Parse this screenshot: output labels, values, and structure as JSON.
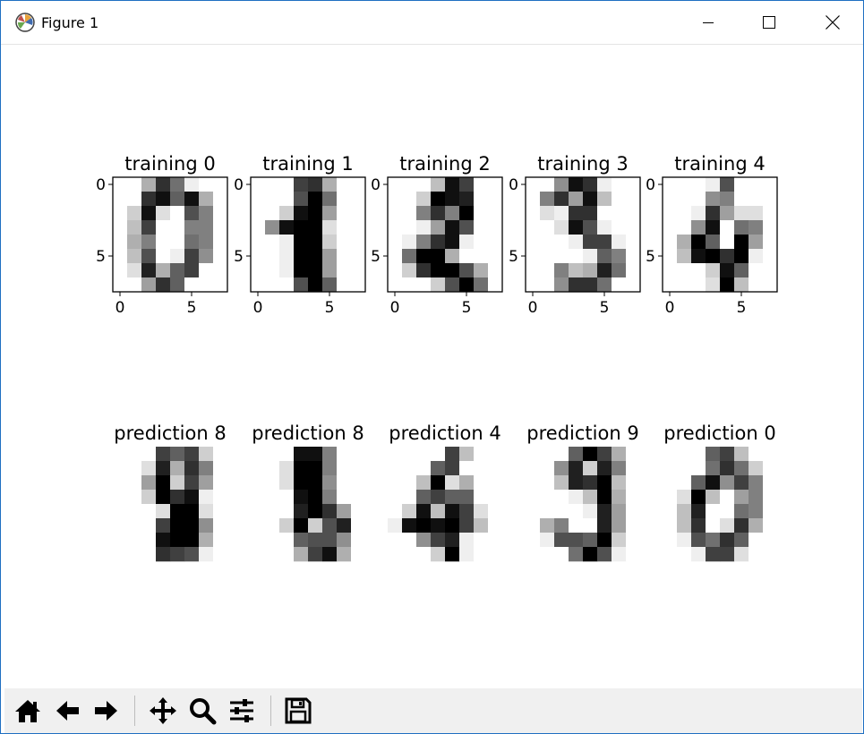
{
  "window": {
    "title": "Figure 1"
  },
  "icons": {
    "app": "matplotlib-icon",
    "minimize": "minimize-icon",
    "maximize": "maximize-icon",
    "close": "close-icon",
    "toolbar": [
      "home-icon",
      "back-arrow-icon",
      "forward-arrow-icon",
      "pan-icon",
      "zoom-icon",
      "configure-subplots-icon",
      "save-icon"
    ]
  },
  "chart_data": {
    "type": "heatmap",
    "colormap": "gray_r",
    "value_range": [
      0,
      16
    ],
    "panels": [
      {
        "title": "training 0",
        "row": "training",
        "axes": true,
        "xticks": [
          "0",
          "5"
        ],
        "yticks": [
          "0",
          "5"
        ],
        "values": [
          [
            0,
            0,
            5,
            13,
            9,
            1,
            0,
            0
          ],
          [
            0,
            0,
            13,
            15,
            10,
            15,
            5,
            0
          ],
          [
            0,
            3,
            15,
            2,
            0,
            11,
            8,
            0
          ],
          [
            0,
            4,
            12,
            0,
            0,
            8,
            8,
            0
          ],
          [
            0,
            5,
            8,
            0,
            0,
            9,
            8,
            0
          ],
          [
            0,
            4,
            11,
            0,
            1,
            12,
            7,
            0
          ],
          [
            0,
            2,
            14,
            5,
            10,
            12,
            0,
            0
          ],
          [
            0,
            0,
            6,
            13,
            10,
            0,
            0,
            0
          ]
        ]
      },
      {
        "title": "training 1",
        "row": "training",
        "axes": true,
        "xticks": [
          "0",
          "5"
        ],
        "yticks": [
          "0",
          "5"
        ],
        "values": [
          [
            0,
            0,
            0,
            12,
            13,
            5,
            0,
            0
          ],
          [
            0,
            0,
            0,
            11,
            16,
            9,
            0,
            0
          ],
          [
            0,
            0,
            3,
            15,
            16,
            6,
            0,
            0
          ],
          [
            0,
            7,
            15,
            16,
            16,
            2,
            0,
            0
          ],
          [
            0,
            0,
            1,
            16,
            16,
            3,
            0,
            0
          ],
          [
            0,
            0,
            1,
            16,
            16,
            6,
            0,
            0
          ],
          [
            0,
            0,
            1,
            16,
            16,
            6,
            0,
            0
          ],
          [
            0,
            0,
            0,
            11,
            16,
            10,
            0,
            0
          ]
        ]
      },
      {
        "title": "training 2",
        "row": "training",
        "axes": true,
        "xticks": [
          "0",
          "5"
        ],
        "yticks": [
          "0",
          "5"
        ],
        "values": [
          [
            0,
            0,
            0,
            4,
            15,
            12,
            0,
            0
          ],
          [
            0,
            0,
            3,
            16,
            15,
            14,
            0,
            0
          ],
          [
            0,
            0,
            8,
            13,
            8,
            16,
            0,
            0
          ],
          [
            0,
            0,
            1,
            6,
            15,
            11,
            0,
            0
          ],
          [
            0,
            1,
            8,
            13,
            15,
            1,
            0,
            0
          ],
          [
            0,
            9,
            16,
            16,
            5,
            0,
            0,
            0
          ],
          [
            0,
            3,
            13,
            16,
            16,
            11,
            5,
            0
          ],
          [
            0,
            0,
            0,
            3,
            11,
            16,
            9,
            0
          ]
        ]
      },
      {
        "title": "training 3",
        "row": "training",
        "axes": true,
        "xticks": [
          "0",
          "5"
        ],
        "yticks": [
          "0",
          "5"
        ],
        "values": [
          [
            0,
            0,
            7,
            15,
            13,
            1,
            0,
            0
          ],
          [
            0,
            8,
            13,
            6,
            15,
            4,
            0,
            0
          ],
          [
            0,
            2,
            1,
            13,
            13,
            0,
            0,
            0
          ],
          [
            0,
            0,
            2,
            15,
            11,
            1,
            0,
            0
          ],
          [
            0,
            0,
            0,
            1,
            12,
            12,
            1,
            0
          ],
          [
            0,
            0,
            0,
            0,
            1,
            10,
            8,
            0
          ],
          [
            0,
            0,
            8,
            4,
            5,
            14,
            9,
            0
          ],
          [
            0,
            0,
            7,
            13,
            13,
            9,
            0,
            0
          ]
        ]
      },
      {
        "title": "training 4",
        "row": "training",
        "axes": true,
        "xticks": [
          "0",
          "5"
        ],
        "yticks": [
          "0",
          "5"
        ],
        "values": [
          [
            0,
            0,
            0,
            1,
            11,
            0,
            0,
            0
          ],
          [
            0,
            0,
            0,
            7,
            8,
            0,
            0,
            0
          ],
          [
            0,
            0,
            1,
            13,
            6,
            2,
            2,
            0
          ],
          [
            0,
            0,
            7,
            15,
            0,
            9,
            8,
            0
          ],
          [
            0,
            5,
            16,
            10,
            0,
            16,
            6,
            0
          ],
          [
            0,
            4,
            15,
            16,
            13,
            16,
            1,
            0
          ],
          [
            0,
            0,
            0,
            3,
            15,
            10,
            0,
            0
          ],
          [
            0,
            0,
            0,
            2,
            16,
            4,
            0,
            0
          ]
        ]
      },
      {
        "title": "prediction 8",
        "row": "prediction",
        "axes": false,
        "values": [
          [
            0,
            0,
            0,
            12,
            10,
            12,
            3,
            0
          ],
          [
            0,
            0,
            2,
            14,
            5,
            13,
            8,
            0
          ],
          [
            0,
            0,
            6,
            16,
            3,
            12,
            6,
            0
          ],
          [
            0,
            0,
            3,
            16,
            13,
            15,
            1,
            0
          ],
          [
            0,
            0,
            0,
            2,
            16,
            16,
            2,
            0
          ],
          [
            0,
            0,
            0,
            12,
            16,
            16,
            7,
            0
          ],
          [
            0,
            0,
            0,
            15,
            16,
            16,
            5,
            0
          ],
          [
            0,
            0,
            0,
            13,
            12,
            11,
            1,
            0
          ]
        ]
      },
      {
        "title": "prediction 8",
        "row": "prediction",
        "axes": false,
        "values": [
          [
            0,
            0,
            0,
            15,
            15,
            8,
            0,
            0
          ],
          [
            0,
            0,
            2,
            16,
            16,
            8,
            0,
            0
          ],
          [
            0,
            0,
            2,
            16,
            16,
            7,
            0,
            0
          ],
          [
            0,
            0,
            0,
            15,
            16,
            8,
            0,
            0
          ],
          [
            0,
            0,
            0,
            14,
            16,
            13,
            6,
            0
          ],
          [
            0,
            0,
            3,
            16,
            3,
            11,
            14,
            0
          ],
          [
            0,
            0,
            0,
            10,
            11,
            11,
            7,
            0
          ],
          [
            0,
            0,
            0,
            5,
            12,
            15,
            5,
            0
          ]
        ]
      },
      {
        "title": "prediction 4",
        "row": "prediction",
        "axes": false,
        "values": [
          [
            0,
            0,
            0,
            0,
            12,
            4,
            0,
            0
          ],
          [
            0,
            0,
            0,
            10,
            12,
            0,
            0,
            0
          ],
          [
            0,
            0,
            4,
            16,
            2,
            5,
            0,
            0
          ],
          [
            0,
            0,
            10,
            12,
            10,
            10,
            0,
            0
          ],
          [
            0,
            3,
            15,
            4,
            15,
            12,
            2,
            0
          ],
          [
            1,
            15,
            16,
            15,
            16,
            12,
            4,
            0
          ],
          [
            0,
            0,
            7,
            12,
            14,
            1,
            0,
            0
          ],
          [
            0,
            0,
            0,
            3,
            16,
            1,
            0,
            0
          ]
        ]
      },
      {
        "title": "prediction 9",
        "row": "prediction",
        "axes": false,
        "values": [
          [
            0,
            0,
            0,
            10,
            16,
            12,
            5,
            0
          ],
          [
            0,
            0,
            7,
            14,
            3,
            14,
            8,
            0
          ],
          [
            0,
            0,
            4,
            14,
            13,
            16,
            4,
            0
          ],
          [
            0,
            0,
            0,
            1,
            4,
            16,
            5,
            0
          ],
          [
            0,
            0,
            0,
            0,
            1,
            14,
            6,
            0
          ],
          [
            0,
            5,
            8,
            0,
            0,
            14,
            6,
            0
          ],
          [
            0,
            1,
            11,
            11,
            10,
            16,
            3,
            0
          ],
          [
            0,
            0,
            0,
            9,
            16,
            11,
            1,
            0
          ]
        ]
      },
      {
        "title": "prediction 0",
        "row": "prediction",
        "axes": false,
        "values": [
          [
            0,
            0,
            0,
            10,
            12,
            4,
            0,
            0
          ],
          [
            0,
            0,
            0,
            9,
            13,
            9,
            3,
            0
          ],
          [
            0,
            0,
            10,
            15,
            7,
            12,
            8,
            0
          ],
          [
            0,
            2,
            16,
            4,
            0,
            6,
            8,
            0
          ],
          [
            0,
            4,
            14,
            0,
            0,
            9,
            8,
            0
          ],
          [
            0,
            4,
            13,
            0,
            2,
            13,
            5,
            0
          ],
          [
            0,
            1,
            11,
            9,
            13,
            10,
            0,
            0
          ],
          [
            0,
            0,
            1,
            12,
            12,
            2,
            0,
            0
          ]
        ]
      }
    ]
  }
}
